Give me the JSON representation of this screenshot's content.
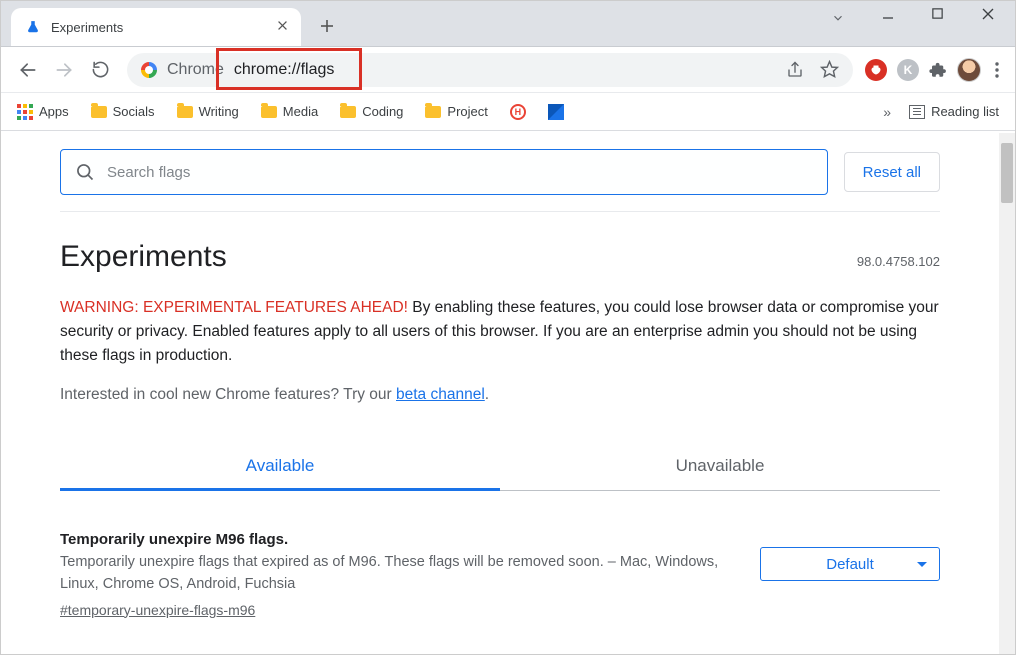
{
  "tab": {
    "title": "Experiments"
  },
  "address": {
    "origin_label": "Chrome",
    "url": "chrome://flags"
  },
  "bookmarks": {
    "apps": "Apps",
    "items": [
      "Socials",
      "Writing",
      "Media",
      "Coding",
      "Project"
    ],
    "reading_list": "Reading list"
  },
  "page": {
    "search_placeholder": "Search flags",
    "reset_label": "Reset all",
    "heading": "Experiments",
    "version": "98.0.4758.102",
    "warning_head": "WARNING: EXPERIMENTAL FEATURES AHEAD!",
    "warning_body": " By enabling these features, you could lose browser data or compromise your security or privacy. Enabled features apply to all users of this browser. If you are an enterprise admin you should not be using these flags in production.",
    "beta_prefix": "Interested in cool new Chrome features? Try our ",
    "beta_link": "beta channel",
    "tabs": {
      "available": "Available",
      "unavailable": "Unavailable"
    },
    "flag": {
      "title": "Temporarily unexpire M96 flags.",
      "desc": "Temporarily unexpire flags that expired as of M96. These flags will be removed soon. – Mac, Windows, Linux, Chrome OS, Android, Fuchsia",
      "hash": "#temporary-unexpire-flags-m96",
      "select": "Default"
    }
  }
}
